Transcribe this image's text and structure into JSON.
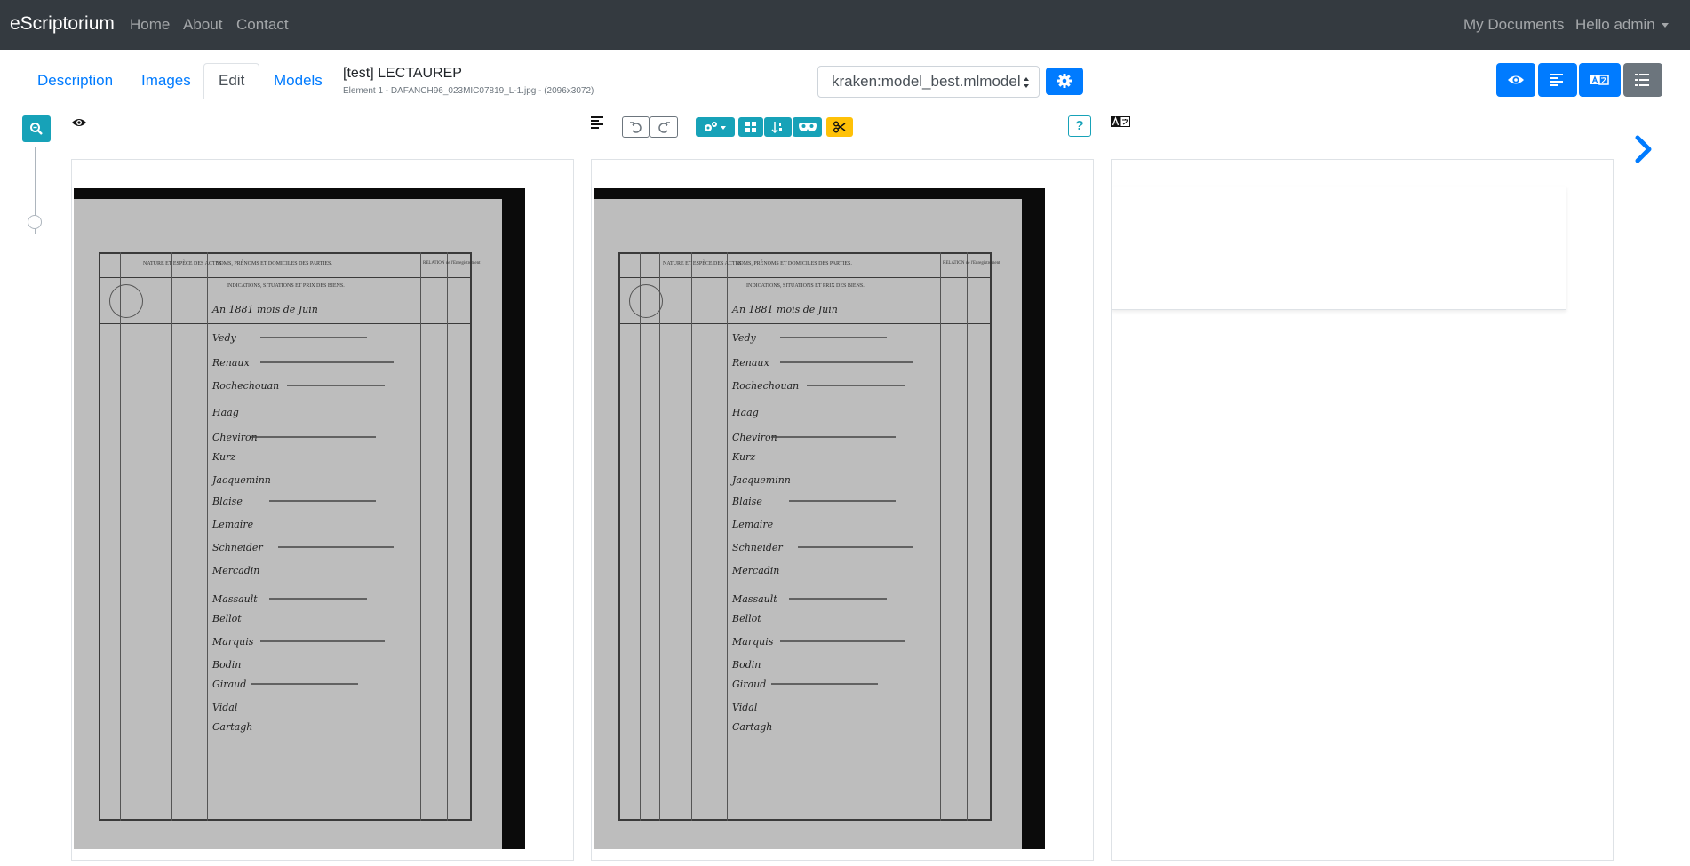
{
  "navbar": {
    "brand": "eScriptorium",
    "links": [
      "Home",
      "About",
      "Contact"
    ],
    "my_documents": "My Documents",
    "user_menu": "Hello admin"
  },
  "tabs": [
    "Description",
    "Images",
    "Edit",
    "Models"
  ],
  "document": {
    "title": "[test] LECTAUREP",
    "subtitle": "Element 1 - DAFANCH96_023MIC07819_L-1.jpg - (2096x3072)"
  },
  "model_select": {
    "selected": "kraken:model_best.mlmodel"
  },
  "panels": [
    {
      "name": "source",
      "scan": {
        "header_cols": [
          "NATURE ET ESPÈCE DES ACTES",
          "NOMS, PRÉNOMS ET DOMICILES DES PARTIES.",
          "RELATION de l'Enregistrement"
        ],
        "header_sub": "INDICATIONS, SITUATIONS ET PRIX DES BIENS.",
        "entries": [
          "An 1881 mois de Juin",
          "Vedy",
          "Renaux",
          "Rochechouan",
          "Haag",
          "Cheviron",
          "Kurz",
          "Jacqueminn",
          "Blaise",
          "Lemaire",
          "Schneider",
          "Mercadin",
          "Massault",
          "Bellot",
          "Marquis",
          "Bodin",
          "Giraud",
          "Vidal",
          "Cartagh"
        ]
      }
    },
    {
      "name": "segmentation",
      "scan": {
        "header_cols": [
          "NATURE ET ESPÈCE DES ACTES",
          "NOMS, PRÉNOMS ET DOMICILES DES PARTIES.",
          "RELATION de l'Enregistrement"
        ],
        "header_sub": "INDICATIONS, SITUATIONS ET PRIX DES BIENS.",
        "entries": [
          "An 1881 mois de Juin",
          "Vedy",
          "Renaux",
          "Rochechouan",
          "Haag",
          "Cheviron",
          "Kurz",
          "Jacqueminn",
          "Blaise",
          "Lemaire",
          "Schneider",
          "Mercadin",
          "Massault",
          "Bellot",
          "Marquis",
          "Bodin",
          "Giraud",
          "Vidal",
          "Cartagh"
        ]
      }
    },
    {
      "name": "transcription"
    }
  ],
  "toolbar": {
    "help_label": "?"
  },
  "colors": {
    "navbar": "#343a40",
    "primary": "#007bff",
    "info": "#17a2b8",
    "warning": "#ffc107",
    "secondary": "#6c757d"
  },
  "icons": [
    "eye-icon",
    "align-left-icon",
    "undo-icon",
    "redo-icon",
    "cogs-icon",
    "grid-icon",
    "sort-icon",
    "mask-icon",
    "scissors-icon",
    "question-icon",
    "translate-icon",
    "zoom-icon",
    "gear-icon",
    "list-icon",
    "chevron-right-icon"
  ]
}
